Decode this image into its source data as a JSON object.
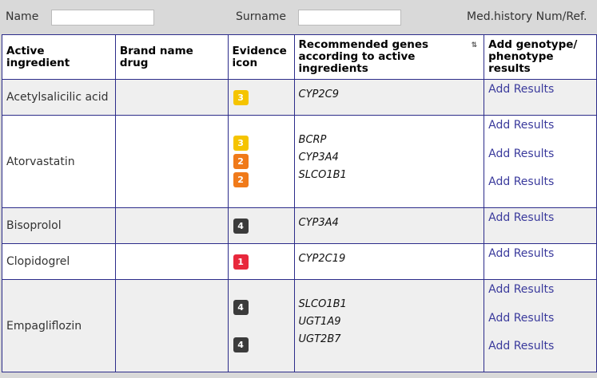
{
  "form": {
    "name_label": "Name",
    "name_value": "",
    "surname_label": "Surname",
    "surname_value": "",
    "medhistory_label": "Med.history Num/Ref."
  },
  "table": {
    "headers": {
      "active_ingredient": "Active ingredient",
      "brand_name": "Brand name drug",
      "evidence": "Evidence icon",
      "genes": "Recommended genes according to active ingredients",
      "add": "Add genotype/ phenotype results"
    },
    "add_label": "Add Results",
    "rows": [
      {
        "ingredient": "Acetylsalicilic acid",
        "brand": "",
        "evidence": [
          "3"
        ],
        "genes": [
          "CYP2C9"
        ]
      },
      {
        "ingredient": "Atorvastatin",
        "brand": "",
        "evidence": [
          "3",
          "2",
          "2"
        ],
        "genes": [
          "BCRP",
          "CYP3A4",
          "SLCO1B1"
        ]
      },
      {
        "ingredient": "Bisoprolol",
        "brand": "",
        "evidence": [
          "4"
        ],
        "genes": [
          "CYP3A4"
        ]
      },
      {
        "ingredient": "Clopidogrel",
        "brand": "",
        "evidence": [
          "1"
        ],
        "genes": [
          "CYP2C19"
        ]
      },
      {
        "ingredient": "Empagliflozin",
        "brand": "",
        "evidence": [
          "4",
          "4"
        ],
        "genes": [
          "SLCO1B1",
          "UGT1A9",
          "UGT2B7"
        ]
      }
    ]
  },
  "colors": {
    "level_1": "#e8283c",
    "level_2": "#f07a1a",
    "level_3": "#f5c400",
    "level_4": "#3b3b3b",
    "border": "#2c2c8a",
    "link": "#3a3a9c"
  }
}
